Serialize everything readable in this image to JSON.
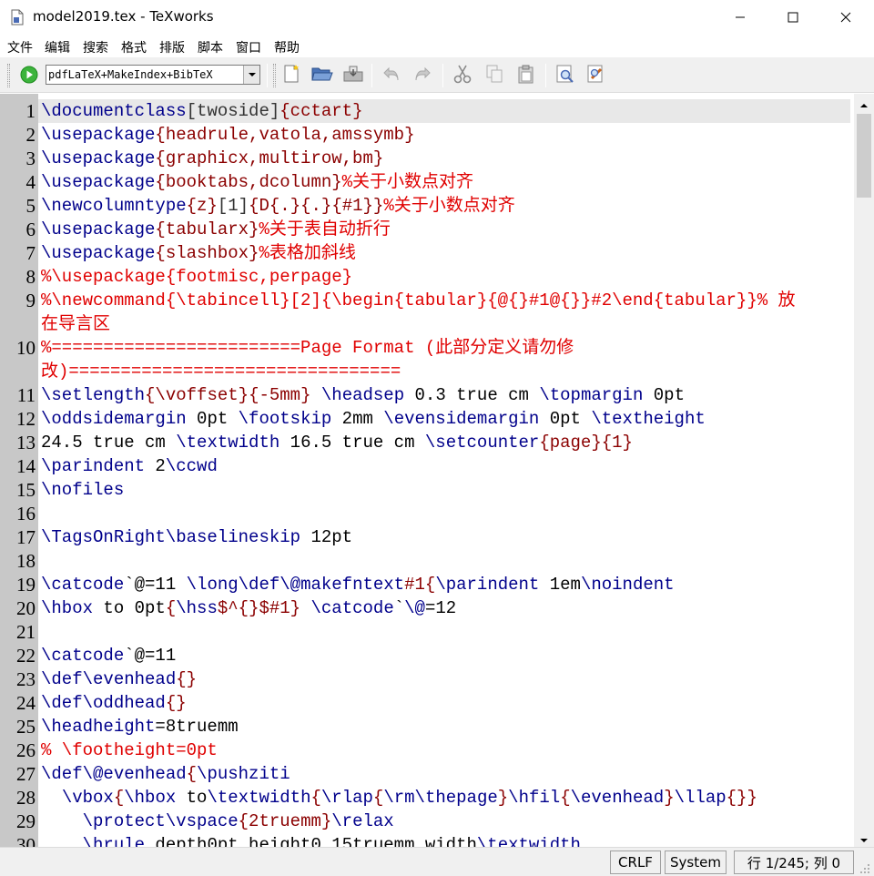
{
  "window": {
    "title": "model2019.tex - TeXworks",
    "icons": [
      "document-icon",
      "minimize-icon",
      "maximize-icon",
      "close-icon"
    ]
  },
  "menu": {
    "items": [
      "文件",
      "编辑",
      "搜索",
      "格式",
      "排版",
      "脚本",
      "窗口",
      "帮助"
    ]
  },
  "toolbar": {
    "engine": "pdfLaTeX+MakeIndex+BibTeX",
    "buttons": [
      "typeset-icon",
      "new-file-icon",
      "open-folder-icon",
      "save-icon",
      "undo-icon",
      "redo-icon",
      "cut-icon",
      "copy-icon",
      "paste-icon",
      "find-icon",
      "replace-icon"
    ],
    "colors": {
      "typeset": "#3cb43c",
      "background": "#f0f0f0"
    }
  },
  "editor": {
    "colors": {
      "command": "#00008b",
      "brace": "#8b0000",
      "comment": "#e00000",
      "gutter": "#c8c8c8",
      "current_line": "#e8e8e8"
    },
    "line_numbers": [
      "1",
      "2",
      "3",
      "4",
      "5",
      "6",
      "7",
      "8",
      "9",
      "10",
      "11",
      "12",
      "13",
      "14",
      "15",
      "16",
      "17",
      "18",
      "19",
      "20",
      "21",
      "22",
      "23",
      "24",
      "25",
      "26",
      "27",
      "28",
      "29",
      "30"
    ],
    "lines": {
      "l1": [
        "\\documentclass",
        "[twoside]",
        "{cctart}"
      ],
      "l2": [
        "\\usepackage",
        "{headrule,vatola,amssymb}"
      ],
      "l3": [
        "\\usepackage",
        "{graphicx,multirow,bm}"
      ],
      "l4": [
        "\\usepackage",
        "{booktabs,dcolumn}",
        "%关于小数点对齐"
      ],
      "l5": [
        "\\newcolumntype",
        "{z}",
        "[1]",
        "{D",
        "{.}",
        "{.}",
        "{#1}}",
        "%关于小数点对齐"
      ],
      "l6": [
        "\\usepackage",
        "{tabularx}",
        "%关于表自动折行"
      ],
      "l7": [
        "\\usepackage",
        "{slashbox}",
        "%表格加斜线"
      ],
      "l8": [
        "%\\usepackage{footmisc,perpage}"
      ],
      "l9a": [
        "%\\newcommand{\\tabincell}[2]{\\begin{tabular}{@{}#1@{}}#2\\end{tabular}}% 放"
      ],
      "l9b": [
        "在导言区"
      ],
      "l10a": [
        "%========================Page Format (此部分定义请勿修"
      ],
      "l10b": [
        "改)================================"
      ],
      "l11": [
        "\\setlength",
        "{\\voffset}",
        "{-5mm}",
        " ",
        "\\headsep",
        " 0.3 true cm ",
        "\\topmargin",
        " 0pt"
      ],
      "l12": [
        "\\oddsidemargin",
        " 0pt ",
        "\\footskip",
        " 2mm ",
        "\\evensidemargin",
        " 0pt ",
        "\\textheight"
      ],
      "l13": [
        "24.5 true cm ",
        "\\textwidth",
        " 16.5 true cm ",
        "\\setcounter",
        "{page}",
        "{1}"
      ],
      "l14": [
        "\\parindent",
        " 2",
        "\\ccwd"
      ],
      "l15": [
        "\\nofiles"
      ],
      "l17": [
        "\\TagsOnRight",
        "\\baselineskip",
        " 12pt"
      ],
      "l19": [
        "\\catcode",
        "`@=11 ",
        "\\long",
        "\\def",
        "\\@makefntext",
        "#1",
        "{",
        "\\parindent",
        " 1em",
        "\\noindent"
      ],
      "l20": [
        "\\hbox",
        " to 0pt",
        "{",
        "\\hss",
        "$^{}$",
        "#1}",
        " ",
        "\\catcode",
        "`",
        "\\@",
        "=12"
      ],
      "l22": [
        "\\catcode",
        "`@=11"
      ],
      "l23": [
        "\\def",
        "\\evenhead",
        "{}"
      ],
      "l24": [
        "\\def",
        "\\oddhead",
        "{}"
      ],
      "l25": [
        "\\headheight",
        "=8truemm"
      ],
      "l26": [
        "% \\footheight=0pt"
      ],
      "l27": [
        "\\def",
        "\\@evenhead",
        "{",
        "\\pushziti"
      ],
      "l28": [
        "  ",
        "\\vbox",
        "{",
        "\\hbox",
        " to",
        "\\textwidth",
        "{",
        "\\rlap",
        "{",
        "\\rm",
        "\\thepage",
        "}",
        "\\hfil",
        "{",
        "\\evenhead",
        "}",
        "\\llap",
        "{}}"
      ],
      "l29": [
        "    ",
        "\\protect",
        "\\vspace",
        "{2truemm}",
        "\\relax"
      ],
      "l30": [
        "    ",
        "\\hrule",
        " depth0pt height0.15truemm width",
        "\\textwidth"
      ]
    }
  },
  "statusbar": {
    "line_ending": "CRLF",
    "encoding": "System",
    "position": "行 1/245; 列 0"
  }
}
